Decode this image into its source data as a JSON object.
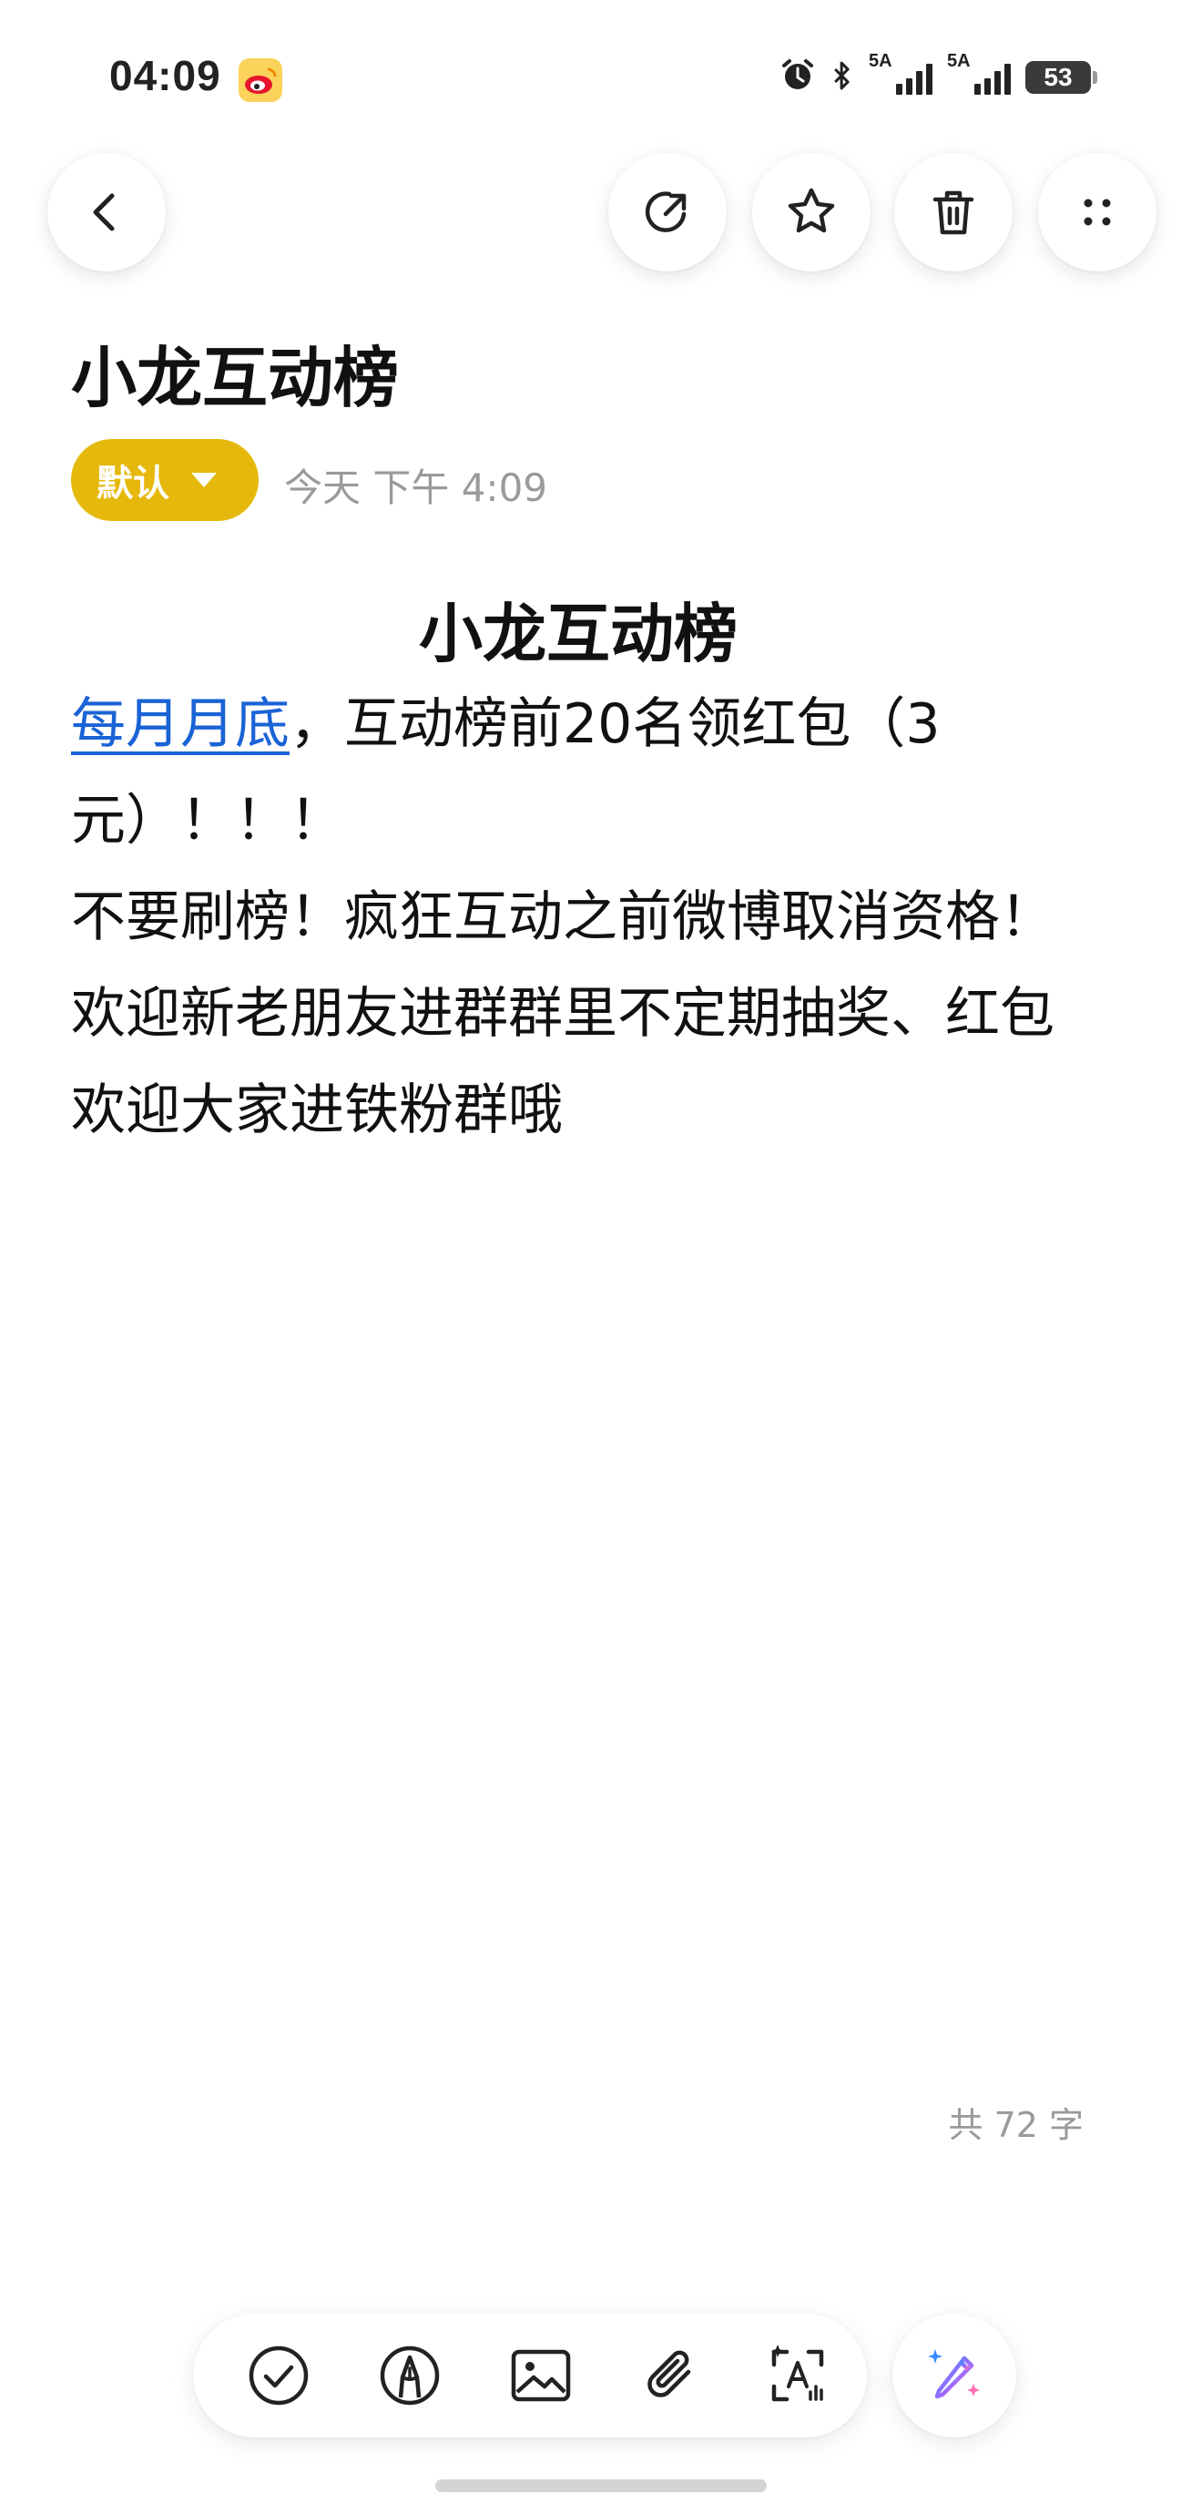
{
  "status_bar": {
    "time": "04:09",
    "signal1_label": "5A",
    "signal2_label": "5A",
    "battery": "53"
  },
  "top_actions": {
    "back": "back-icon",
    "share": "share-icon",
    "favorite": "star-icon",
    "delete": "trash-icon",
    "more": "more-icon"
  },
  "note": {
    "title": "小龙互动榜",
    "folder": "默认",
    "date": "今天 下午 4:09",
    "heading": "小龙互动榜",
    "link_text": "每月月底",
    "body_1": "，互动榜前20名领红包（3元）！！！",
    "body_2": "不要刷榜！疯狂互动之前微博取消资格！欢迎新老朋友进群群里不定期抽奖、红包欢迎大家进铁粉群哦",
    "word_count": "共 72 字"
  },
  "toolbar": {
    "items": [
      "checklist-icon",
      "pen-icon",
      "image-icon",
      "attachment-icon",
      "text-recognition-icon"
    ],
    "ai": "ai-magic-pen-icon"
  },
  "colors": {
    "accent": "#e5b80b",
    "link": "#1a63d6",
    "muted": "#9a9a9a",
    "text": "#111111"
  }
}
